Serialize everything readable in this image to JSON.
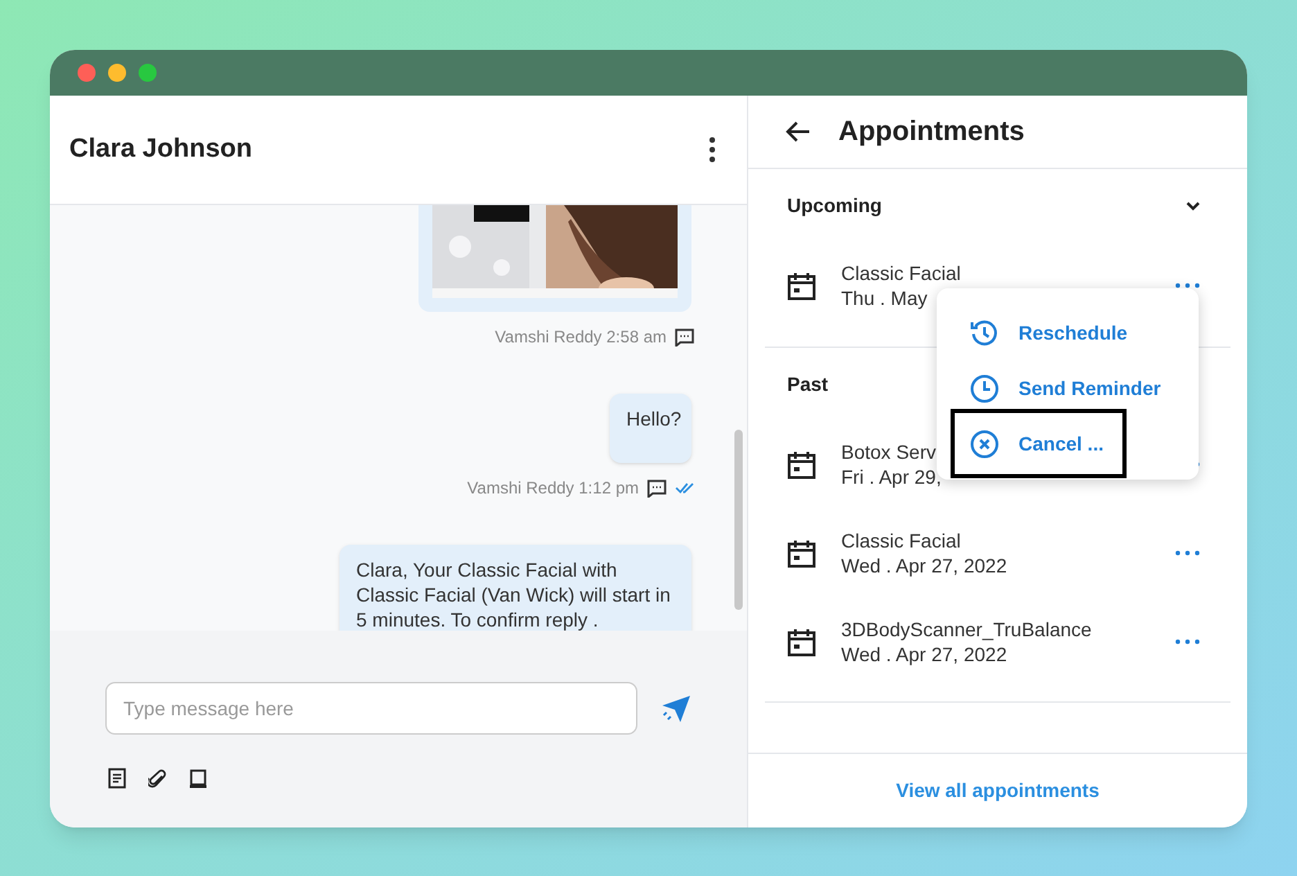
{
  "chat": {
    "contact_name": "Clara Johnson",
    "messages": [
      {
        "sender": "Vamshi Reddy",
        "time": "2:58 am",
        "read": false
      },
      {
        "kind": "text",
        "text": "Hello?",
        "sender": "Vamshi Reddy",
        "time": "1:12 pm",
        "read": true
      },
      {
        "kind": "text",
        "text": "Clara, Your Classic Facial with Classic Facial (Van Wick) will start in 5 minutes. To confirm reply ."
      }
    ],
    "composer": {
      "placeholder": "Type message here"
    }
  },
  "appointments": {
    "title": "Appointments",
    "sections": [
      {
        "label": "Upcoming",
        "expanded": true,
        "items": [
          {
            "name": "Classic Facial",
            "date": "Thu . May"
          }
        ]
      },
      {
        "label": "Past",
        "items": [
          {
            "name": "Botox Serv",
            "date": "Fri . Apr 29,"
          },
          {
            "name": "Classic Facial",
            "date": "Wed . Apr 27, 2022"
          },
          {
            "name": "3DBodyScanner_TruBalance",
            "date": "Wed . Apr 27, 2022"
          }
        ]
      }
    ],
    "menu": [
      {
        "kind": "reschedule",
        "label": "Reschedule",
        "highlighted": false
      },
      {
        "kind": "reminder",
        "label": "Send Reminder",
        "highlighted": false
      },
      {
        "kind": "cancel",
        "label": "Cancel ...",
        "highlighted": true
      }
    ],
    "footer_link": "View all appointments"
  }
}
